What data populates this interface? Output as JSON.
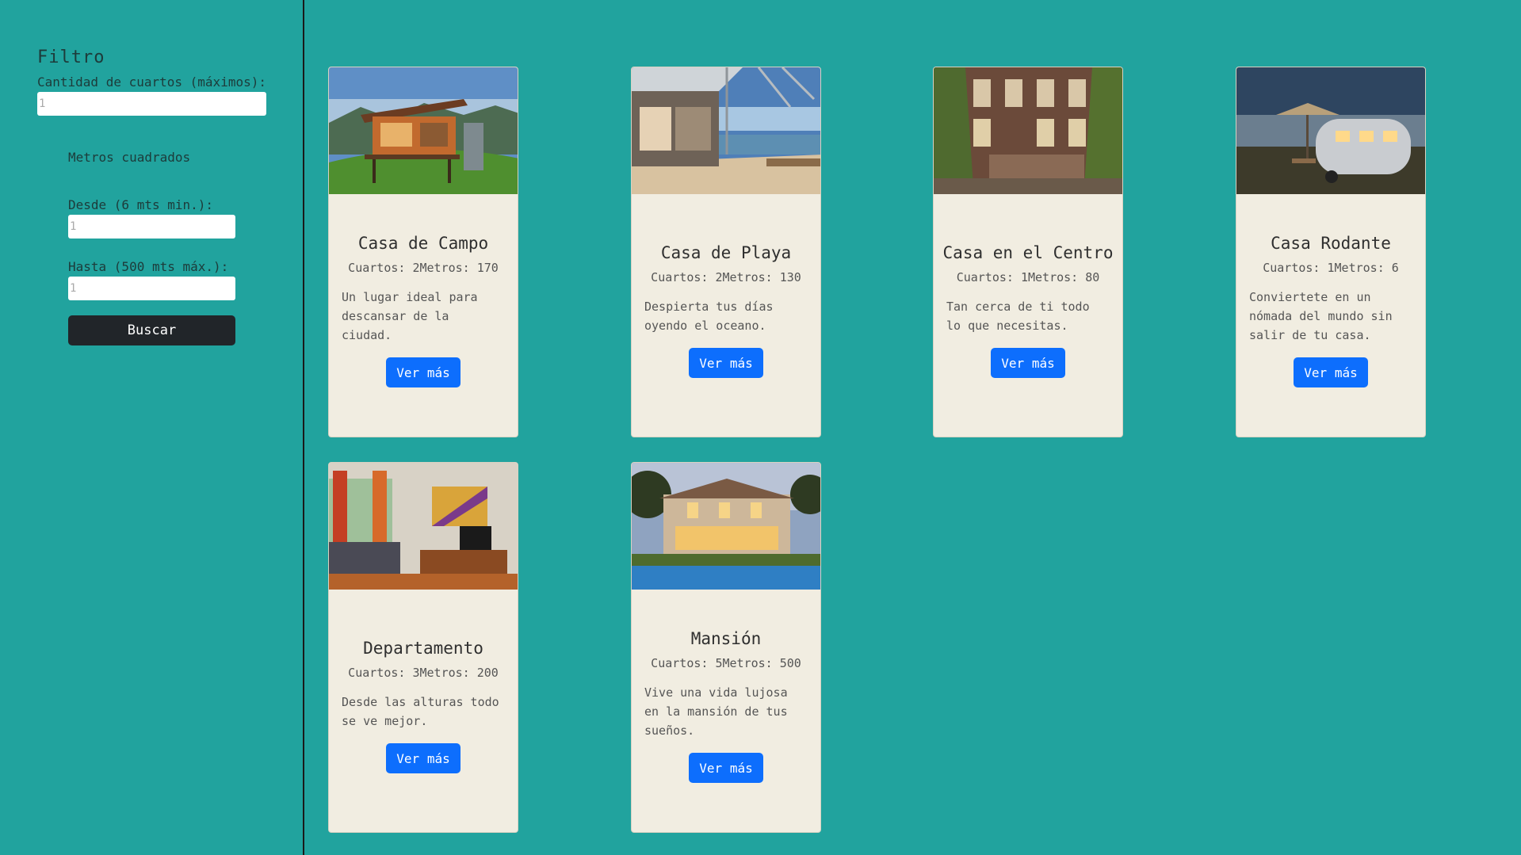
{
  "sidebar": {
    "title": "Filtro",
    "rooms_label": "Cantidad de cuartos (máximos):",
    "rooms_value": "1",
    "area_label": "Metros cuadrados",
    "from_label": "Desde (6 mts min.):",
    "from_value": "1",
    "to_label": "Hasta (500 mts máx.):",
    "to_value": "1",
    "search_button": "Buscar"
  },
  "cards": [
    {
      "title": "Casa de Campo",
      "rooms": "Cuartos: 2",
      "meters": "Metros: 170",
      "description": "Un lugar ideal para descansar de la ciudad.",
      "button": "Ver más",
      "image": "country-house-image"
    },
    {
      "title": "Casa de Playa",
      "rooms": "Cuartos: 2",
      "meters": "Metros: 130",
      "description": "Despierta tus días oyendo el oceano.",
      "button": "Ver más",
      "image": "beach-house-image"
    },
    {
      "title": "Casa en el Centro",
      "rooms": "Cuartos: 1",
      "meters": "Metros: 80",
      "description": "Tan cerca de ti todo lo que necesitas.",
      "button": "Ver más",
      "image": "downtown-house-image"
    },
    {
      "title": "Casa Rodante",
      "rooms": "Cuartos: 1",
      "meters": "Metros: 6",
      "description": "Conviertete en un nómada del mundo sin salir de tu casa.",
      "button": "Ver más",
      "image": "trailer-image"
    },
    {
      "title": "Departamento",
      "rooms": "Cuartos: 3",
      "meters": "Metros: 200",
      "description": "Desde las alturas todo se ve mejor.",
      "button": "Ver más",
      "image": "apartment-image"
    },
    {
      "title": "Mansión",
      "rooms": "Cuartos: 5",
      "meters": "Metros: 500",
      "description": "Vive una vida lujosa en la mansión de tus sueños.",
      "button": "Ver más",
      "image": "mansion-image"
    }
  ],
  "colors": {
    "background": "#21a39e",
    "card": "#f1ede1",
    "primary_button": "#0d6efd",
    "dark_button": "#212529"
  }
}
